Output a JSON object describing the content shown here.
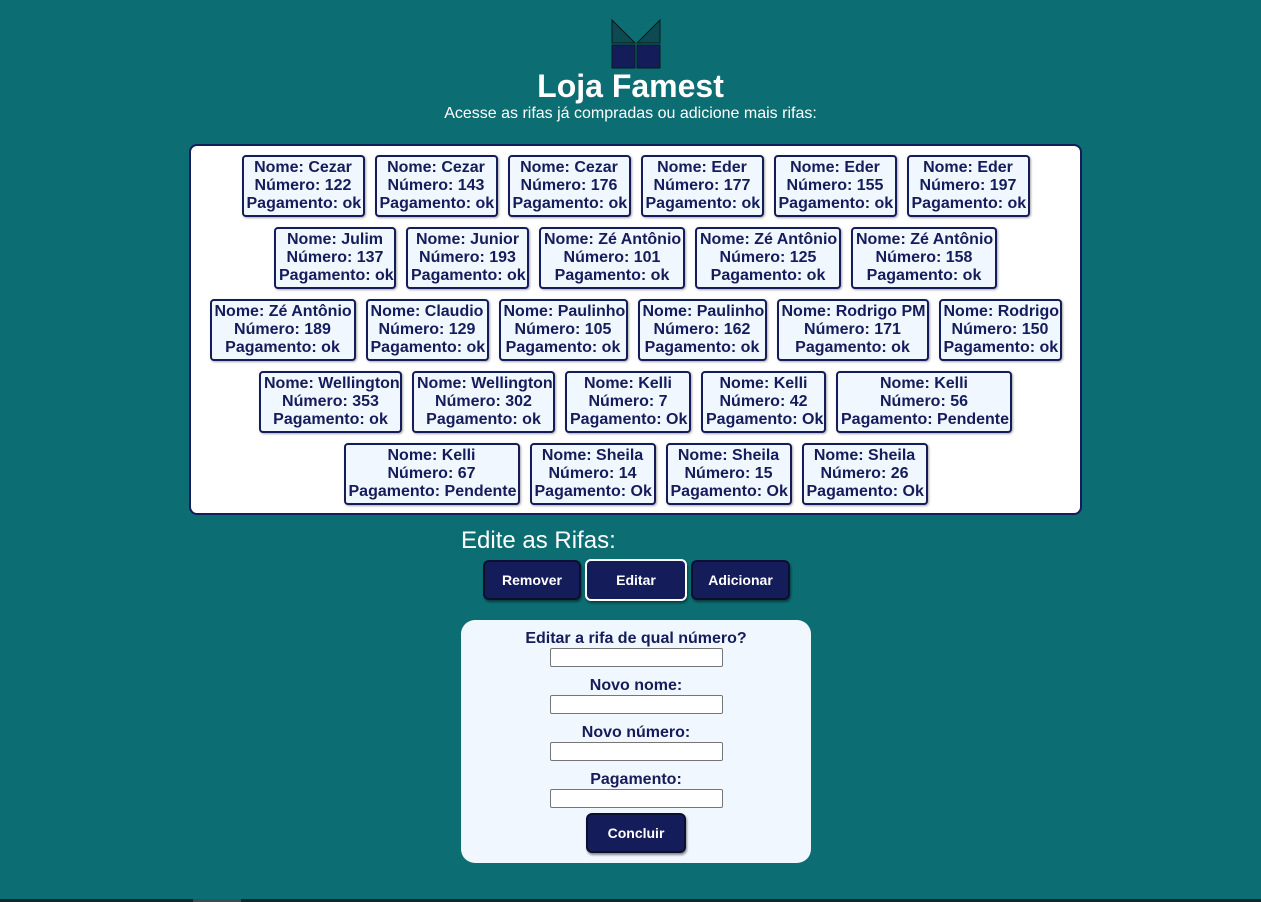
{
  "header": {
    "title": "Loja Famest",
    "subtitle": "Acesse as rifas já compradas ou adicione mais rifas:"
  },
  "raffles": [
    [
      {
        "nome": "Nome: Cezar",
        "numero": "Número: 122",
        "pagamento": "Pagamento: ok"
      },
      {
        "nome": "Nome: Cezar",
        "numero": "Número: 143",
        "pagamento": "Pagamento: ok"
      },
      {
        "nome": "Nome: Cezar",
        "numero": "Número: 176",
        "pagamento": "Pagamento: ok"
      },
      {
        "nome": "Nome: Eder",
        "numero": "Número: 177",
        "pagamento": "Pagamento: ok"
      },
      {
        "nome": "Nome: Eder",
        "numero": "Número: 155",
        "pagamento": "Pagamento: ok"
      },
      {
        "nome": "Nome: Eder",
        "numero": "Número: 197",
        "pagamento": "Pagamento: ok"
      }
    ],
    [
      {
        "nome": "Nome: Julim",
        "numero": "Número: 137",
        "pagamento": "Pagamento: ok"
      },
      {
        "nome": "Nome: Junior",
        "numero": "Número: 193",
        "pagamento": "Pagamento: ok"
      },
      {
        "nome": "Nome: Zé Antônio",
        "numero": "Número: 101",
        "pagamento": "Pagamento: ok"
      },
      {
        "nome": "Nome: Zé Antônio",
        "numero": "Número: 125",
        "pagamento": "Pagamento: ok"
      },
      {
        "nome": "Nome: Zé Antônio",
        "numero": "Número: 158",
        "pagamento": "Pagamento: ok"
      }
    ],
    [
      {
        "nome": "Nome: Zé Antônio",
        "numero": "Número: 189",
        "pagamento": "Pagamento: ok"
      },
      {
        "nome": "Nome: Claudio",
        "numero": "Número: 129",
        "pagamento": "Pagamento: ok"
      },
      {
        "nome": "Nome: Paulinho",
        "numero": "Número: 105",
        "pagamento": "Pagamento: ok"
      },
      {
        "nome": "Nome: Paulinho",
        "numero": "Número: 162",
        "pagamento": "Pagamento: ok"
      },
      {
        "nome": "Nome: Rodrigo PM",
        "numero": "Número: 171",
        "pagamento": "Pagamento: ok"
      },
      {
        "nome": "Nome: Rodrigo",
        "numero": "Número: 150",
        "pagamento": "Pagamento: ok"
      }
    ],
    [
      {
        "nome": "Nome: Wellington",
        "numero": "Número: 353",
        "pagamento": "Pagamento: ok"
      },
      {
        "nome": "Nome: Wellington",
        "numero": "Número: 302",
        "pagamento": "Pagamento: ok"
      },
      {
        "nome": "Nome: Kelli",
        "numero": "Número: 7",
        "pagamento": "Pagamento: Ok"
      },
      {
        "nome": "Nome: Kelli",
        "numero": "Número: 42",
        "pagamento": "Pagamento: Ok"
      },
      {
        "nome": "Nome: Kelli",
        "numero": "Número: 56",
        "pagamento": "Pagamento: Pendente"
      }
    ],
    [
      {
        "nome": "Nome: Kelli",
        "numero": "Número: 67",
        "pagamento": "Pagamento: Pendente"
      },
      {
        "nome": "Nome: Sheila",
        "numero": "Número: 14",
        "pagamento": "Pagamento: Ok"
      },
      {
        "nome": "Nome: Sheila",
        "numero": "Número: 15",
        "pagamento": "Pagamento: Ok"
      },
      {
        "nome": "Nome: Sheila",
        "numero": "Número: 26",
        "pagamento": "Pagamento: Ok"
      }
    ]
  ],
  "edit_section": {
    "title": "Edite as Rifas:",
    "buttons": {
      "remove": "Remover",
      "edit": "Editar",
      "add": "Adicionar"
    },
    "active_button": "edit"
  },
  "edit_form": {
    "number_label": "Editar a rifa de qual número?",
    "name_label": "Novo nome:",
    "new_number_label": "Novo número:",
    "payment_label": "Pagamento:",
    "number_value": "",
    "name_value": "",
    "new_number_value": "",
    "payment_value": "",
    "submit_label": "Concluir"
  },
  "colors": {
    "background": "#0c6e72",
    "navy": "#151c5a",
    "card_bg": "#f0f7ff",
    "logo_dark": "#0d4a52"
  },
  "icons": {
    "logo": "box-logo-icon"
  }
}
